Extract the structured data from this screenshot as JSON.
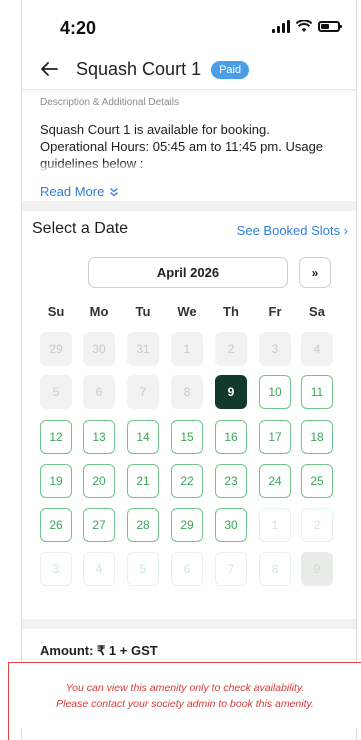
{
  "status_bar": {
    "time": "4:20"
  },
  "header": {
    "title": "Squash Court 1",
    "badge": "Paid"
  },
  "description": {
    "label": "Description & Additional Details",
    "text": "Squash Court 1 is available for booking. Operational Hours: 05:45 am to 11:45 pm. Usage guidelines below :",
    "read_more": "Read More"
  },
  "date_picker": {
    "title": "Select a Date",
    "booked_link": "See Booked Slots",
    "month": "April 2026",
    "next_label": "»",
    "weekdays": [
      "Su",
      "Mo",
      "Tu",
      "We",
      "Th",
      "Fr",
      "Sa"
    ],
    "selected_date": "9",
    "weeks": [
      [
        {
          "d": "29",
          "s": "past"
        },
        {
          "d": "30",
          "s": "past"
        },
        {
          "d": "31",
          "s": "past"
        },
        {
          "d": "1",
          "s": "past"
        },
        {
          "d": "2",
          "s": "past"
        },
        {
          "d": "3",
          "s": "past"
        },
        {
          "d": "4",
          "s": "past"
        }
      ],
      [
        {
          "d": "5",
          "s": "past"
        },
        {
          "d": "6",
          "s": "past"
        },
        {
          "d": "7",
          "s": "past"
        },
        {
          "d": "8",
          "s": "past"
        },
        {
          "d": "9",
          "s": "selected"
        },
        {
          "d": "10",
          "s": "avail"
        },
        {
          "d": "11",
          "s": "avail"
        }
      ],
      [
        {
          "d": "12",
          "s": "avail"
        },
        {
          "d": "13",
          "s": "avail"
        },
        {
          "d": "14",
          "s": "avail"
        },
        {
          "d": "15",
          "s": "avail"
        },
        {
          "d": "16",
          "s": "avail"
        },
        {
          "d": "17",
          "s": "avail"
        },
        {
          "d": "18",
          "s": "avail"
        }
      ],
      [
        {
          "d": "19",
          "s": "avail"
        },
        {
          "d": "20",
          "s": "avail"
        },
        {
          "d": "21",
          "s": "avail"
        },
        {
          "d": "22",
          "s": "avail"
        },
        {
          "d": "23",
          "s": "avail"
        },
        {
          "d": "24",
          "s": "avail"
        },
        {
          "d": "25",
          "s": "avail"
        }
      ],
      [
        {
          "d": "26",
          "s": "avail"
        },
        {
          "d": "27",
          "s": "avail"
        },
        {
          "d": "28",
          "s": "avail"
        },
        {
          "d": "29",
          "s": "avail"
        },
        {
          "d": "30",
          "s": "avail"
        },
        {
          "d": "1",
          "s": "faded"
        },
        {
          "d": "2",
          "s": "faded"
        }
      ],
      [
        {
          "d": "3",
          "s": "faded"
        },
        {
          "d": "4",
          "s": "faded"
        },
        {
          "d": "5",
          "s": "faded"
        },
        {
          "d": "6",
          "s": "faded"
        },
        {
          "d": "7",
          "s": "faded"
        },
        {
          "d": "8",
          "s": "faded"
        },
        {
          "d": "9",
          "s": "faded-grey"
        }
      ]
    ]
  },
  "amount": "Amount: ₹ 1 + GST",
  "notice": {
    "line1": "You can view this amenity only to check availability.",
    "line2": "Please contact your society admin to book this amenity."
  },
  "colors": {
    "accent_blue": "#2f80d9",
    "available_green": "#3aa65a",
    "selected_dark": "#123a2c",
    "notice_red": "#d63b3b"
  },
  "icons": [
    "signal-icon",
    "wifi-icon",
    "battery-icon",
    "back-arrow-icon",
    "double-chevron-down-icon",
    "chevron-right-icon"
  ]
}
